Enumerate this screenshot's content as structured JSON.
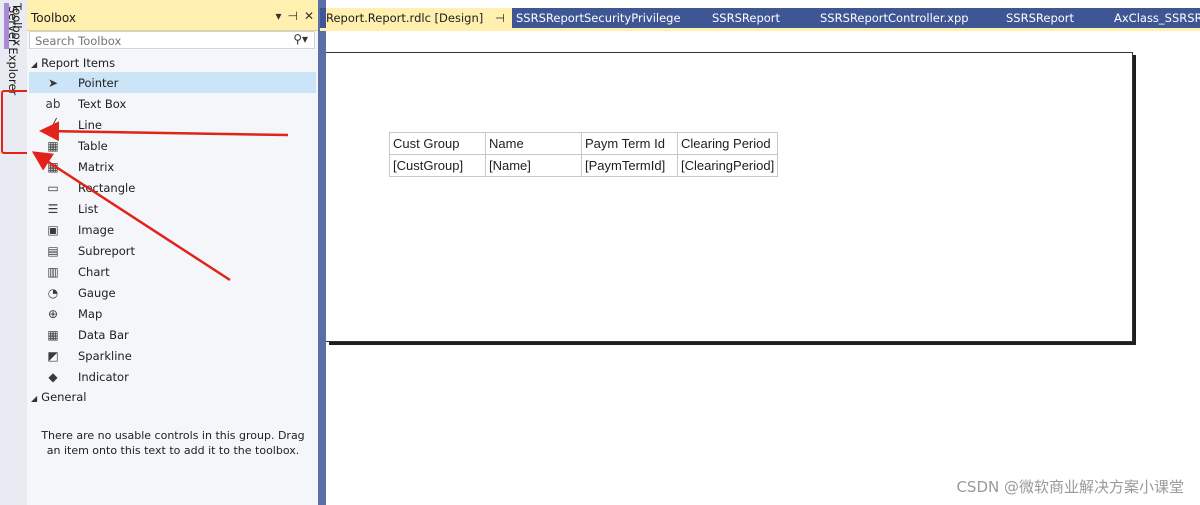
{
  "side_strip": {
    "server_explorer_label": "Server Explorer",
    "toolbox_label": "Toolbox"
  },
  "toolbox": {
    "title": "Toolbox",
    "title_buttons": [
      "▾",
      "⊣",
      "✕"
    ],
    "search_placeholder": "Search Toolbox",
    "search_icon": "search-icon",
    "report_items_header": "Report Items",
    "items": [
      {
        "label": "Pointer",
        "icon": "pointer-icon",
        "glyph": "➤",
        "selected": true
      },
      {
        "label": "Text Box",
        "icon": "textbox-icon",
        "glyph": "ab",
        "selected": false
      },
      {
        "label": "Line",
        "icon": "line-icon",
        "glyph": "╱",
        "selected": false
      },
      {
        "label": "Table",
        "icon": "table-icon",
        "glyph": "▦",
        "selected": false
      },
      {
        "label": "Matrix",
        "icon": "matrix-icon",
        "glyph": "▦",
        "selected": false
      },
      {
        "label": "Rectangle",
        "icon": "rectangle-icon",
        "glyph": "▭",
        "selected": false
      },
      {
        "label": "List",
        "icon": "list-icon",
        "glyph": "☰",
        "selected": false
      },
      {
        "label": "Image",
        "icon": "image-icon",
        "glyph": "▣",
        "selected": false
      },
      {
        "label": "Subreport",
        "icon": "subreport-icon",
        "glyph": "▤",
        "selected": false
      },
      {
        "label": "Chart",
        "icon": "chart-icon",
        "glyph": "▥",
        "selected": false
      },
      {
        "label": "Gauge",
        "icon": "gauge-icon",
        "glyph": "◔",
        "selected": false
      },
      {
        "label": "Map",
        "icon": "map-icon",
        "glyph": "⊕",
        "selected": false
      },
      {
        "label": "Data Bar",
        "icon": "databar-icon",
        "glyph": "▦",
        "selected": false
      },
      {
        "label": "Sparkline",
        "icon": "sparkline-icon",
        "glyph": "◩",
        "selected": false
      },
      {
        "label": "Indicator",
        "icon": "indicator-icon",
        "glyph": "◆",
        "selected": false
      }
    ],
    "general_header": "General",
    "general_message": "There are no usable controls in this group. Drag an item onto this text to add it to the toolbox."
  },
  "tabs": [
    {
      "label": "Report.Report.rdlc [Design]",
      "active": true,
      "pin": "⊣",
      "close": "✕"
    },
    {
      "label": "SSRSReportSecurityPrivilege",
      "active": false
    },
    {
      "label": "SSRSReport",
      "active": false
    },
    {
      "label": "SSRSReportController.xpp",
      "active": false
    },
    {
      "label": "SSRSReport",
      "active": false
    },
    {
      "label": "AxClass_SSRSRe",
      "active": false
    }
  ],
  "report_table": {
    "headers": [
      "Cust Group",
      "Name",
      "Paym Term Id",
      "Clearing Period"
    ],
    "fields": [
      "[CustGroup]",
      "[Name]",
      "[PaymTermId]",
      "[ClearingPeriod]"
    ]
  },
  "watermark": "CSDN @微软商业解决方案小课堂",
  "colors": {
    "tab_strip": "#3f5695",
    "active_tab": "#fff0b0",
    "highlight": "#e2231a",
    "selected_item": "#cce4f7"
  }
}
